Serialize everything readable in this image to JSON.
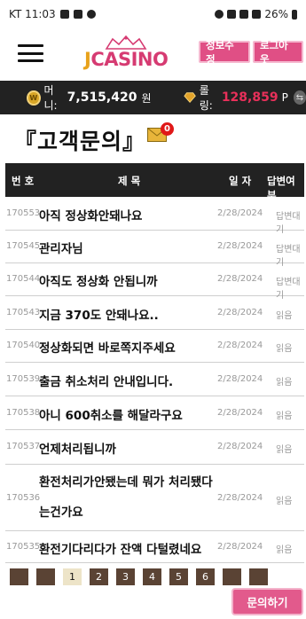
{
  "statusbar": {
    "time": "KT 11:03",
    "battery": "26%"
  },
  "header": {
    "logo_j": "J",
    "logo_rest": "CASINO",
    "info_button": "정보수정",
    "logout_button": "로그아웃"
  },
  "userbar": {
    "money_label": "머니:",
    "money_value": "7,515,420",
    "money_unit": "원",
    "rolling_label": "롤링:",
    "rolling_value": "128,859",
    "rolling_unit": "P"
  },
  "page": {
    "title": "『고객문의』",
    "mail_badge": "0"
  },
  "table": {
    "headers": {
      "num": "번 호",
      "subject": "제 목",
      "date": "일 자",
      "status": "답변여부"
    },
    "rows": [
      {
        "num": "170553",
        "subject": "아직 정상화안돼나요",
        "date": "2/28/2024",
        "status": "답변대기"
      },
      {
        "num": "170545",
        "subject": "관리자님",
        "date": "2/28/2024",
        "status": "답변대기"
      },
      {
        "num": "170544",
        "subject": "아직도 정상화 안됩니까",
        "date": "2/28/2024",
        "status": "답변대기"
      },
      {
        "num": "170543",
        "subject": "지금 370도 안돼나요..",
        "date": "2/28/2024",
        "status": "읽음"
      },
      {
        "num": "170540",
        "subject": "정상화되면 바로쪽지주세요",
        "date": "2/28/2024",
        "status": "읽음"
      },
      {
        "num": "170539",
        "subject": "출금 취소처리 안내입니다.",
        "date": "2/28/2024",
        "status": "읽음"
      },
      {
        "num": "170538",
        "subject": "아니 600취소를 해달라구요",
        "date": "2/28/2024",
        "status": "읽음"
      },
      {
        "num": "170537",
        "subject": "언제처리됩니까",
        "date": "2/28/2024",
        "status": "읽음"
      },
      {
        "num": "170536",
        "subject": "환전처리가안됐는데 뭐가 처리됐다는건가요",
        "date": "2/28/2024",
        "status": "읽음"
      },
      {
        "num": "170535",
        "subject": "환전기다리다가 잔액 다털렸네요",
        "date": "2/28/2024",
        "status": "읽음"
      }
    ]
  },
  "pagination": {
    "pages": [
      "1",
      "2",
      "3",
      "4",
      "5",
      "6"
    ],
    "current": "1"
  },
  "inquiry_button": "문의하기",
  "colors": {
    "accent_pink": "#e04f85",
    "bar_dark": "#222222",
    "rolling_red": "#e8305a",
    "pager_brown": "#5a4334"
  }
}
